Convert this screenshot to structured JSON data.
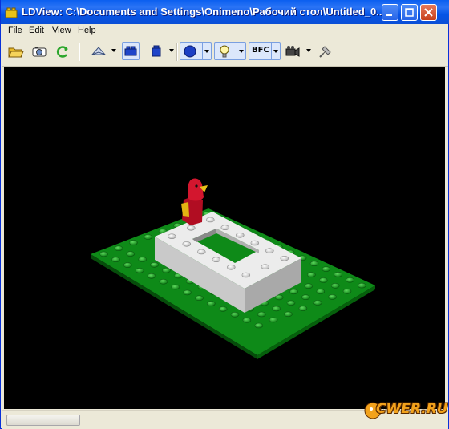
{
  "window": {
    "title": "LDView: C:\\Documents and Settings\\Onimeno\\Рабочий стол\\Untitled_0..."
  },
  "menu": [
    "File",
    "Edit",
    "View",
    "Help"
  ],
  "toolbar": {
    "bfc_label": "BFC"
  },
  "watermark": {
    "text": "CWER.RU"
  },
  "colors": {
    "title_blue": "#0a5ff0",
    "baseplate_green": "#0e8a18",
    "brick_white": "#dcdcdc",
    "minifig_red": "#c8102e",
    "background": "#000000"
  },
  "icons": [
    "open-folder-icon",
    "camera-snapshot-icon",
    "reload-icon",
    "view-mode-icon",
    "brick-wireframe-icon",
    "brick-shaded-icon",
    "sphere-quality-icon",
    "lightbulb-icon",
    "bfc-icon",
    "camera-view-icon",
    "preferences-icon"
  ]
}
